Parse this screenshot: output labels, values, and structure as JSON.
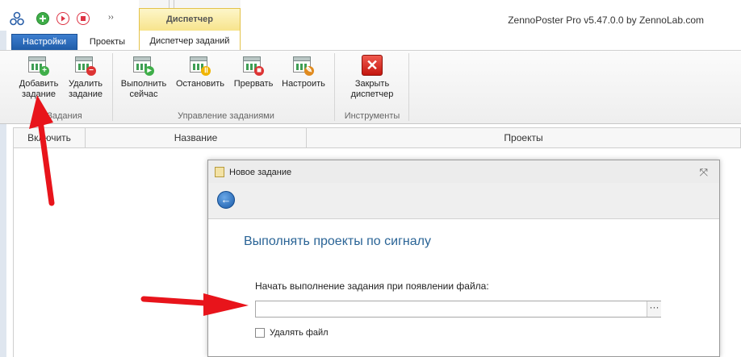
{
  "app": {
    "title": "ZennoPoster Pro v5.47.0.0 by ZennoLab.com",
    "context_tab": "Диспетчер"
  },
  "tabs": [
    {
      "label": "Настройки",
      "active": false
    },
    {
      "label": "Проекты",
      "active": false
    },
    {
      "label": "Диспетчер заданий",
      "active": true
    }
  ],
  "ribbon": {
    "groups": [
      {
        "label": "Задания",
        "buttons": [
          {
            "label_line1": "Добавить",
            "label_line2": "задание",
            "icon": "calendar-add-icon"
          },
          {
            "label_line1": "Удалить",
            "label_line2": "задание",
            "icon": "calendar-delete-icon"
          }
        ]
      },
      {
        "label": "Управление заданиями",
        "buttons": [
          {
            "label_line1": "Выполнить",
            "label_line2": "сейчас",
            "icon": "calendar-play-icon"
          },
          {
            "label_line1": "Остановить",
            "label_line2": "",
            "icon": "calendar-pause-icon"
          },
          {
            "label_line1": "Прервать",
            "label_line2": "",
            "icon": "calendar-stop-icon"
          },
          {
            "label_line1": "Настроить",
            "label_line2": "",
            "icon": "calendar-edit-icon"
          }
        ]
      },
      {
        "label": "Инструменты",
        "buttons": [
          {
            "label_line1": "Закрыть",
            "label_line2": "диспетчер",
            "icon": "close-red-icon"
          }
        ]
      }
    ]
  },
  "grid": {
    "columns": [
      "Включить",
      "Название",
      "Проекты"
    ]
  },
  "dialog": {
    "title": "Новое задание",
    "heading": "Выполнять проекты по сигналу",
    "file_label": "Начать выполнение задания при появлении файла:",
    "file_value": "",
    "browse_label": "···",
    "delete_file_label": "Удалять файл",
    "delete_file_checked": false
  },
  "colors": {
    "ribbon_tab_blue": "#2a67b5",
    "context_yellow": "#f7e38a",
    "arrow_red": "#e8141b",
    "heading_blue": "#2a6496"
  }
}
